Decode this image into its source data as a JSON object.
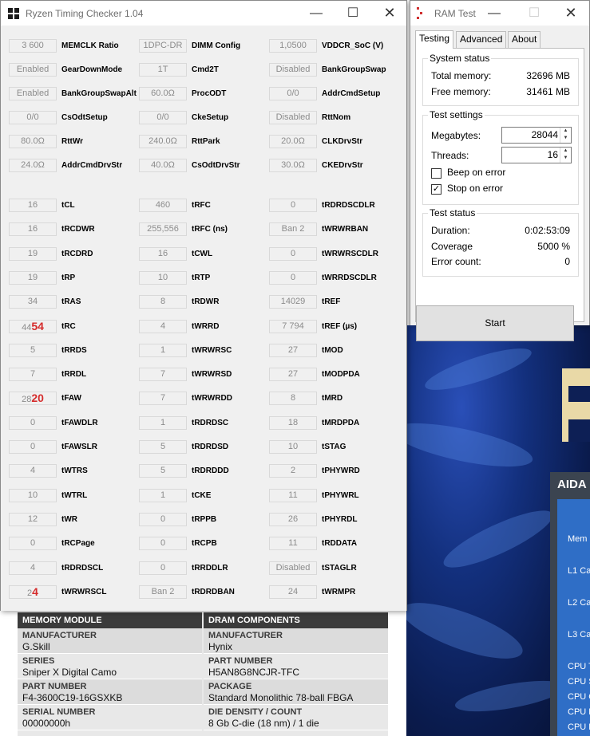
{
  "rtc": {
    "title": "Ryzen Timing Checker 1.04",
    "rows_top": [
      [
        {
          "value": "3 600",
          "label": "MEMCLK Ratio"
        },
        {
          "value": "1DPC-DR",
          "label": "DIMM Config"
        },
        {
          "value": "1,0500",
          "label": "VDDCR_SoC (V)"
        }
      ],
      [
        {
          "value": "Enabled",
          "label": "GearDownMode"
        },
        {
          "value": "1T",
          "label": "Cmd2T"
        },
        {
          "value": "Disabled",
          "label": "BankGroupSwap"
        }
      ],
      [
        {
          "value": "Enabled",
          "label": "BankGroupSwapAlt"
        },
        {
          "value": "60.0Ω",
          "label": "ProcODT"
        },
        {
          "value": "0/0",
          "label": "AddrCmdSetup"
        }
      ],
      [
        {
          "value": "0/0",
          "label": "CsOdtSetup"
        },
        {
          "value": "0/0",
          "label": "CkeSetup"
        },
        {
          "value": "Disabled",
          "label": "RttNom"
        }
      ],
      [
        {
          "value": "80.0Ω",
          "label": "RttWr"
        },
        {
          "value": "240.0Ω",
          "label": "RttPark"
        },
        {
          "value": "20.0Ω",
          "label": "CLKDrvStr"
        }
      ],
      [
        {
          "value": "24.0Ω",
          "label": "AddrCmdDrvStr"
        },
        {
          "value": "40.0Ω",
          "label": "CsOdtDrvStr"
        },
        {
          "value": "30.0Ω",
          "label": "CKEDrvStr"
        }
      ]
    ],
    "rows_timings": [
      [
        {
          "value": "16",
          "label": "tCL"
        },
        {
          "value": "460",
          "label": "tRFC"
        },
        {
          "value": "0",
          "label": "tRDRDSCDLR"
        }
      ],
      [
        {
          "value": "16",
          "label": "tRCDWR"
        },
        {
          "value": "255,556",
          "label": "tRFC (ns)"
        },
        {
          "value": "Ban 2",
          "label": "tWRWRBAN"
        }
      ],
      [
        {
          "value": "19",
          "label": "tRCDRD"
        },
        {
          "value": "16",
          "label": "tCWL"
        },
        {
          "value": "0",
          "label": "tWRWRSCDLR"
        }
      ],
      [
        {
          "value": "19",
          "label": "tRP"
        },
        {
          "value": "10",
          "label": "tRTP"
        },
        {
          "value": "0",
          "label": "tWRRDSCDLR"
        }
      ],
      [
        {
          "value": "34",
          "label": "tRAS"
        },
        {
          "value": "8",
          "label": "tRDWR"
        },
        {
          "value": "14029",
          "label": "tREF"
        }
      ],
      [
        {
          "value": "44",
          "overlay": "54",
          "label": "tRC"
        },
        {
          "value": "4",
          "label": "tWRRD"
        },
        {
          "value": "7 794",
          "label": "tREF (µs)"
        }
      ],
      [
        {
          "value": "5",
          "label": "tRRDS"
        },
        {
          "value": "1",
          "label": "tWRWRSC"
        },
        {
          "value": "27",
          "label": "tMOD"
        }
      ],
      [
        {
          "value": "7",
          "label": "tRRDL"
        },
        {
          "value": "7",
          "label": "tWRWRSD"
        },
        {
          "value": "27",
          "label": "tMODPDA"
        }
      ],
      [
        {
          "value": "28",
          "overlay": "20",
          "label": "tFAW"
        },
        {
          "value": "7",
          "label": "tWRWRDD"
        },
        {
          "value": "8",
          "label": "tMRD"
        }
      ],
      [
        {
          "value": "0",
          "label": "tFAWDLR"
        },
        {
          "value": "1",
          "label": "tRDRDSC"
        },
        {
          "value": "18",
          "label": "tMRDPDA"
        }
      ],
      [
        {
          "value": "0",
          "label": "tFAWSLR"
        },
        {
          "value": "5",
          "label": "tRDRDSD"
        },
        {
          "value": "10",
          "label": "tSTAG"
        }
      ],
      [
        {
          "value": "4",
          "label": "tWTRS"
        },
        {
          "value": "5",
          "label": "tRDRDDD"
        },
        {
          "value": "2",
          "label": "tPHYWRD"
        }
      ],
      [
        {
          "value": "10",
          "label": "tWTRL"
        },
        {
          "value": "1",
          "label": "tCKE"
        },
        {
          "value": "11",
          "label": "tPHYWRL"
        }
      ],
      [
        {
          "value": "12",
          "label": "tWR"
        },
        {
          "value": "0",
          "label": "tRPPB"
        },
        {
          "value": "26",
          "label": "tPHYRDL"
        }
      ],
      [
        {
          "value": "0",
          "label": "tRCPage"
        },
        {
          "value": "0",
          "label": "tRCPB"
        },
        {
          "value": "11",
          "label": "tRDDATA"
        }
      ],
      [
        {
          "value": "4",
          "label": "tRDRDSCL"
        },
        {
          "value": "0",
          "label": "tRRDDLR"
        },
        {
          "value": "Disabled",
          "label": "tSTAGLR"
        }
      ],
      [
        {
          "value": "2",
          "overlay": "4",
          "label": "tWRWRSCL"
        },
        {
          "value": "Ban 2",
          "label": "tRDRDBAN"
        },
        {
          "value": "24",
          "label": "tWRMPR"
        }
      ]
    ]
  },
  "ramtest": {
    "title": "RAM Test",
    "tabs": [
      "Testing",
      "Advanced",
      "About"
    ],
    "system_status": {
      "heading": "System status",
      "total_label": "Total memory:",
      "total_value": "32696 MB",
      "free_label": "Free memory:",
      "free_value": "31461 MB"
    },
    "test_settings": {
      "heading": "Test settings",
      "megabytes_label": "Megabytes:",
      "megabytes_value": "28044",
      "threads_label": "Threads:",
      "threads_value": "16",
      "beep_label": "Beep on error",
      "beep_checked": false,
      "stop_label": "Stop on error",
      "stop_checked": true
    },
    "test_status": {
      "heading": "Test status",
      "duration_label": "Duration:",
      "duration_value": "0:02:53:09",
      "coverage_label": "Coverage",
      "coverage_value": "5000 %",
      "errors_label": "Error count:",
      "errors_value": "0"
    },
    "start_label": "Start"
  },
  "module_table": {
    "left_header": "MEMORY MODULE",
    "right_header": "DRAM COMPONENTS",
    "left": [
      {
        "k": "MANUFACTURER",
        "v": "G.Skill"
      },
      {
        "k": "SERIES",
        "v": "Sniper X Digital Camo"
      },
      {
        "k": "PART NUMBER",
        "v": "F4-3600C19-16GSXKB"
      },
      {
        "k": "SERIAL NUMBER",
        "v": "00000000h"
      }
    ],
    "right": [
      {
        "k": "MANUFACTURER",
        "v": "Hynix"
      },
      {
        "k": "PART NUMBER",
        "v": "H5AN8G8NCJR-TFC"
      },
      {
        "k": "PACKAGE",
        "v": "Standard Monolithic 78-ball FBGA"
      },
      {
        "k": "DIE DENSITY / COUNT",
        "v": "8 Gb C-die (18 nm) / 1 die"
      }
    ]
  },
  "aida": {
    "title": "AIDA",
    "labels": [
      "Mem",
      "L1 Ca",
      "L2 Ca",
      "L3 Ca",
      "CPU T",
      "CPU S",
      "CPU C",
      "CPU F",
      "CPU M"
    ]
  },
  "colors": {
    "accent_red": "#d52b2b",
    "desktop_blue": "#13307e"
  }
}
